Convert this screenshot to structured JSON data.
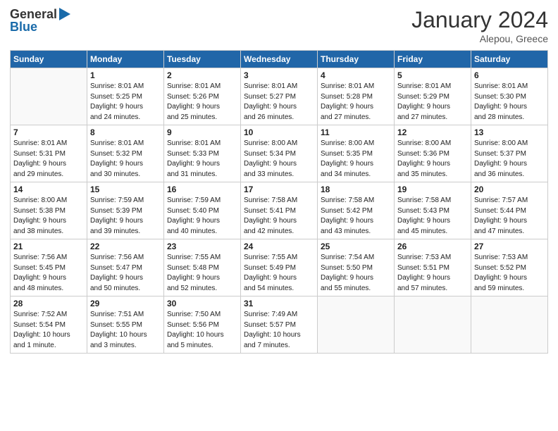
{
  "header": {
    "logo_general": "General",
    "logo_blue": "Blue",
    "month_year": "January 2024",
    "location": "Alepou, Greece"
  },
  "weekdays": [
    "Sunday",
    "Monday",
    "Tuesday",
    "Wednesday",
    "Thursday",
    "Friday",
    "Saturday"
  ],
  "weeks": [
    [
      {
        "day": "",
        "info": ""
      },
      {
        "day": "1",
        "info": "Sunrise: 8:01 AM\nSunset: 5:25 PM\nDaylight: 9 hours\nand 24 minutes."
      },
      {
        "day": "2",
        "info": "Sunrise: 8:01 AM\nSunset: 5:26 PM\nDaylight: 9 hours\nand 25 minutes."
      },
      {
        "day": "3",
        "info": "Sunrise: 8:01 AM\nSunset: 5:27 PM\nDaylight: 9 hours\nand 26 minutes."
      },
      {
        "day": "4",
        "info": "Sunrise: 8:01 AM\nSunset: 5:28 PM\nDaylight: 9 hours\nand 27 minutes."
      },
      {
        "day": "5",
        "info": "Sunrise: 8:01 AM\nSunset: 5:29 PM\nDaylight: 9 hours\nand 27 minutes."
      },
      {
        "day": "6",
        "info": "Sunrise: 8:01 AM\nSunset: 5:30 PM\nDaylight: 9 hours\nand 28 minutes."
      }
    ],
    [
      {
        "day": "7",
        "info": "Sunrise: 8:01 AM\nSunset: 5:31 PM\nDaylight: 9 hours\nand 29 minutes."
      },
      {
        "day": "8",
        "info": "Sunrise: 8:01 AM\nSunset: 5:32 PM\nDaylight: 9 hours\nand 30 minutes."
      },
      {
        "day": "9",
        "info": "Sunrise: 8:01 AM\nSunset: 5:33 PM\nDaylight: 9 hours\nand 31 minutes."
      },
      {
        "day": "10",
        "info": "Sunrise: 8:00 AM\nSunset: 5:34 PM\nDaylight: 9 hours\nand 33 minutes."
      },
      {
        "day": "11",
        "info": "Sunrise: 8:00 AM\nSunset: 5:35 PM\nDaylight: 9 hours\nand 34 minutes."
      },
      {
        "day": "12",
        "info": "Sunrise: 8:00 AM\nSunset: 5:36 PM\nDaylight: 9 hours\nand 35 minutes."
      },
      {
        "day": "13",
        "info": "Sunrise: 8:00 AM\nSunset: 5:37 PM\nDaylight: 9 hours\nand 36 minutes."
      }
    ],
    [
      {
        "day": "14",
        "info": "Sunrise: 8:00 AM\nSunset: 5:38 PM\nDaylight: 9 hours\nand 38 minutes."
      },
      {
        "day": "15",
        "info": "Sunrise: 7:59 AM\nSunset: 5:39 PM\nDaylight: 9 hours\nand 39 minutes."
      },
      {
        "day": "16",
        "info": "Sunrise: 7:59 AM\nSunset: 5:40 PM\nDaylight: 9 hours\nand 40 minutes."
      },
      {
        "day": "17",
        "info": "Sunrise: 7:58 AM\nSunset: 5:41 PM\nDaylight: 9 hours\nand 42 minutes."
      },
      {
        "day": "18",
        "info": "Sunrise: 7:58 AM\nSunset: 5:42 PM\nDaylight: 9 hours\nand 43 minutes."
      },
      {
        "day": "19",
        "info": "Sunrise: 7:58 AM\nSunset: 5:43 PM\nDaylight: 9 hours\nand 45 minutes."
      },
      {
        "day": "20",
        "info": "Sunrise: 7:57 AM\nSunset: 5:44 PM\nDaylight: 9 hours\nand 47 minutes."
      }
    ],
    [
      {
        "day": "21",
        "info": "Sunrise: 7:56 AM\nSunset: 5:45 PM\nDaylight: 9 hours\nand 48 minutes."
      },
      {
        "day": "22",
        "info": "Sunrise: 7:56 AM\nSunset: 5:47 PM\nDaylight: 9 hours\nand 50 minutes."
      },
      {
        "day": "23",
        "info": "Sunrise: 7:55 AM\nSunset: 5:48 PM\nDaylight: 9 hours\nand 52 minutes."
      },
      {
        "day": "24",
        "info": "Sunrise: 7:55 AM\nSunset: 5:49 PM\nDaylight: 9 hours\nand 54 minutes."
      },
      {
        "day": "25",
        "info": "Sunrise: 7:54 AM\nSunset: 5:50 PM\nDaylight: 9 hours\nand 55 minutes."
      },
      {
        "day": "26",
        "info": "Sunrise: 7:53 AM\nSunset: 5:51 PM\nDaylight: 9 hours\nand 57 minutes."
      },
      {
        "day": "27",
        "info": "Sunrise: 7:53 AM\nSunset: 5:52 PM\nDaylight: 9 hours\nand 59 minutes."
      }
    ],
    [
      {
        "day": "28",
        "info": "Sunrise: 7:52 AM\nSunset: 5:54 PM\nDaylight: 10 hours\nand 1 minute."
      },
      {
        "day": "29",
        "info": "Sunrise: 7:51 AM\nSunset: 5:55 PM\nDaylight: 10 hours\nand 3 minutes."
      },
      {
        "day": "30",
        "info": "Sunrise: 7:50 AM\nSunset: 5:56 PM\nDaylight: 10 hours\nand 5 minutes."
      },
      {
        "day": "31",
        "info": "Sunrise: 7:49 AM\nSunset: 5:57 PM\nDaylight: 10 hours\nand 7 minutes."
      },
      {
        "day": "",
        "info": ""
      },
      {
        "day": "",
        "info": ""
      },
      {
        "day": "",
        "info": ""
      }
    ]
  ]
}
